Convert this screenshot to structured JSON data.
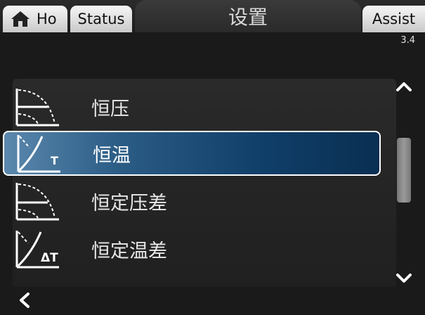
{
  "tabs": {
    "home": "Ho",
    "status": "Status",
    "settings": "设置",
    "assist": "Assist"
  },
  "version": "3.4",
  "menu": {
    "items": [
      {
        "label": "恒压",
        "icon": "constant-pressure-icon",
        "selected": false
      },
      {
        "label": "恒温",
        "icon": "constant-temperature-icon",
        "selected": true
      },
      {
        "label": "恒定压差",
        "icon": "constant-differential-pressure-icon",
        "selected": false
      },
      {
        "label": "恒定温差",
        "icon": "constant-differential-temperature-icon",
        "selected": false
      }
    ]
  },
  "colors": {
    "selected_bg": "#0f3e68",
    "selected_border": "#ffffff",
    "tab_active": "#2f2f2f",
    "tab_inactive": "#e6e6e6"
  }
}
